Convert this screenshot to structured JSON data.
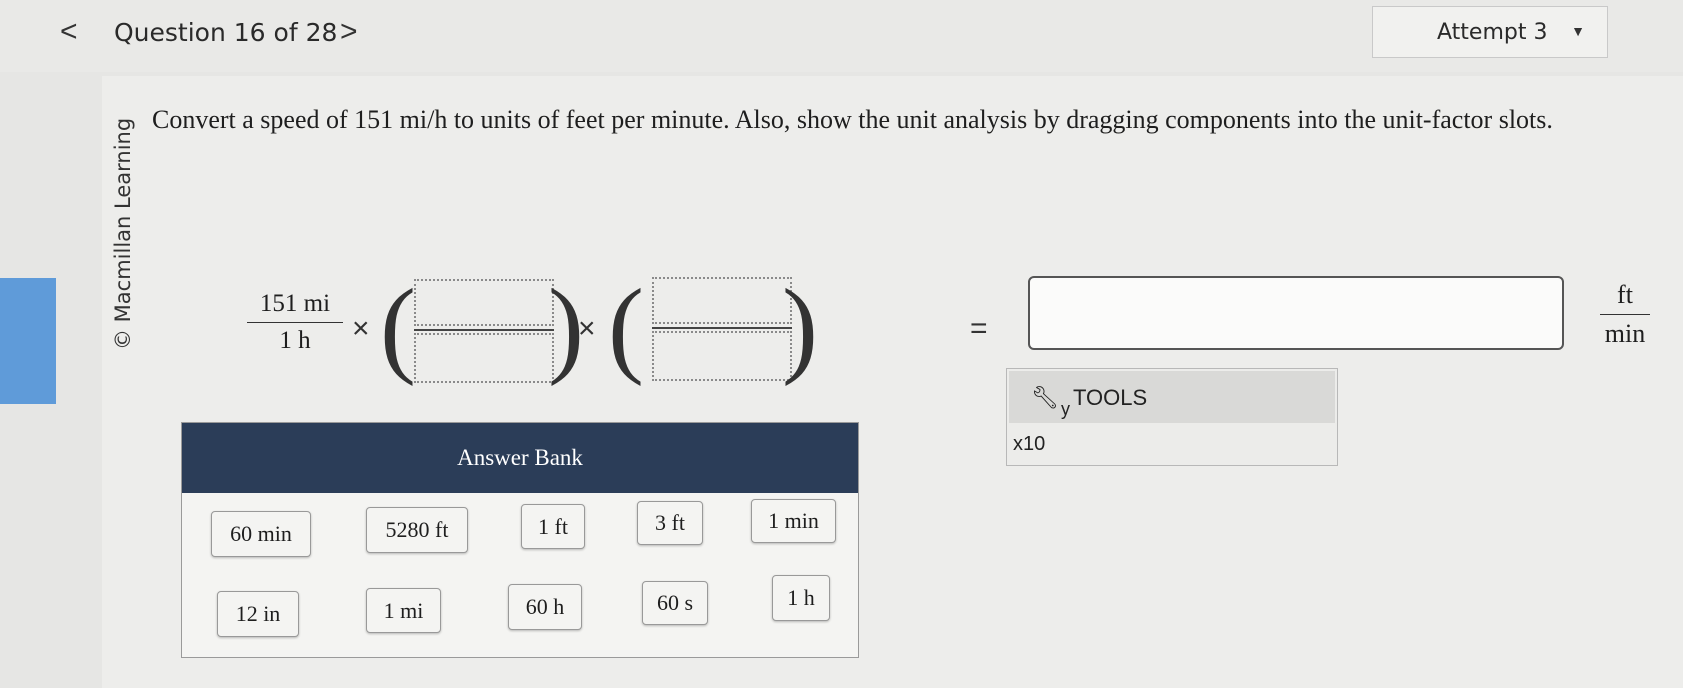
{
  "nav": {
    "prev_glyph": "<",
    "next_glyph": ">",
    "question_label": "Question 16 of 28"
  },
  "attempt": {
    "label": "Attempt 3",
    "caret": "▼"
  },
  "watermark": "© Macmillan Learning",
  "prompt": "Convert a speed of 151 mi/h to units of feet per minute. Also, show the unit analysis by dragging components into the unit-factor slots.",
  "expression": {
    "given_numerator": "151 mi",
    "given_denominator": "1 h",
    "times": "×",
    "equals": "=",
    "open_paren": "(",
    "close_paren": ")",
    "result_value": "",
    "result_unit_numerator": "ft",
    "result_unit_denominator": "min"
  },
  "tools": {
    "label": "TOOLS",
    "subscript": "y",
    "x10_label": "x10"
  },
  "answer_bank": {
    "title": "Answer Bank",
    "chips": [
      "60 min",
      "5280 ft",
      "1 ft",
      "3 ft",
      "1 min",
      "12 in",
      "1 mi",
      "60 h",
      "60 s",
      "1 h"
    ]
  },
  "colors": {
    "bank_header": "#2b3d58",
    "left_accent": "#5f9bd9",
    "page_bg": "#e6e6e4"
  }
}
